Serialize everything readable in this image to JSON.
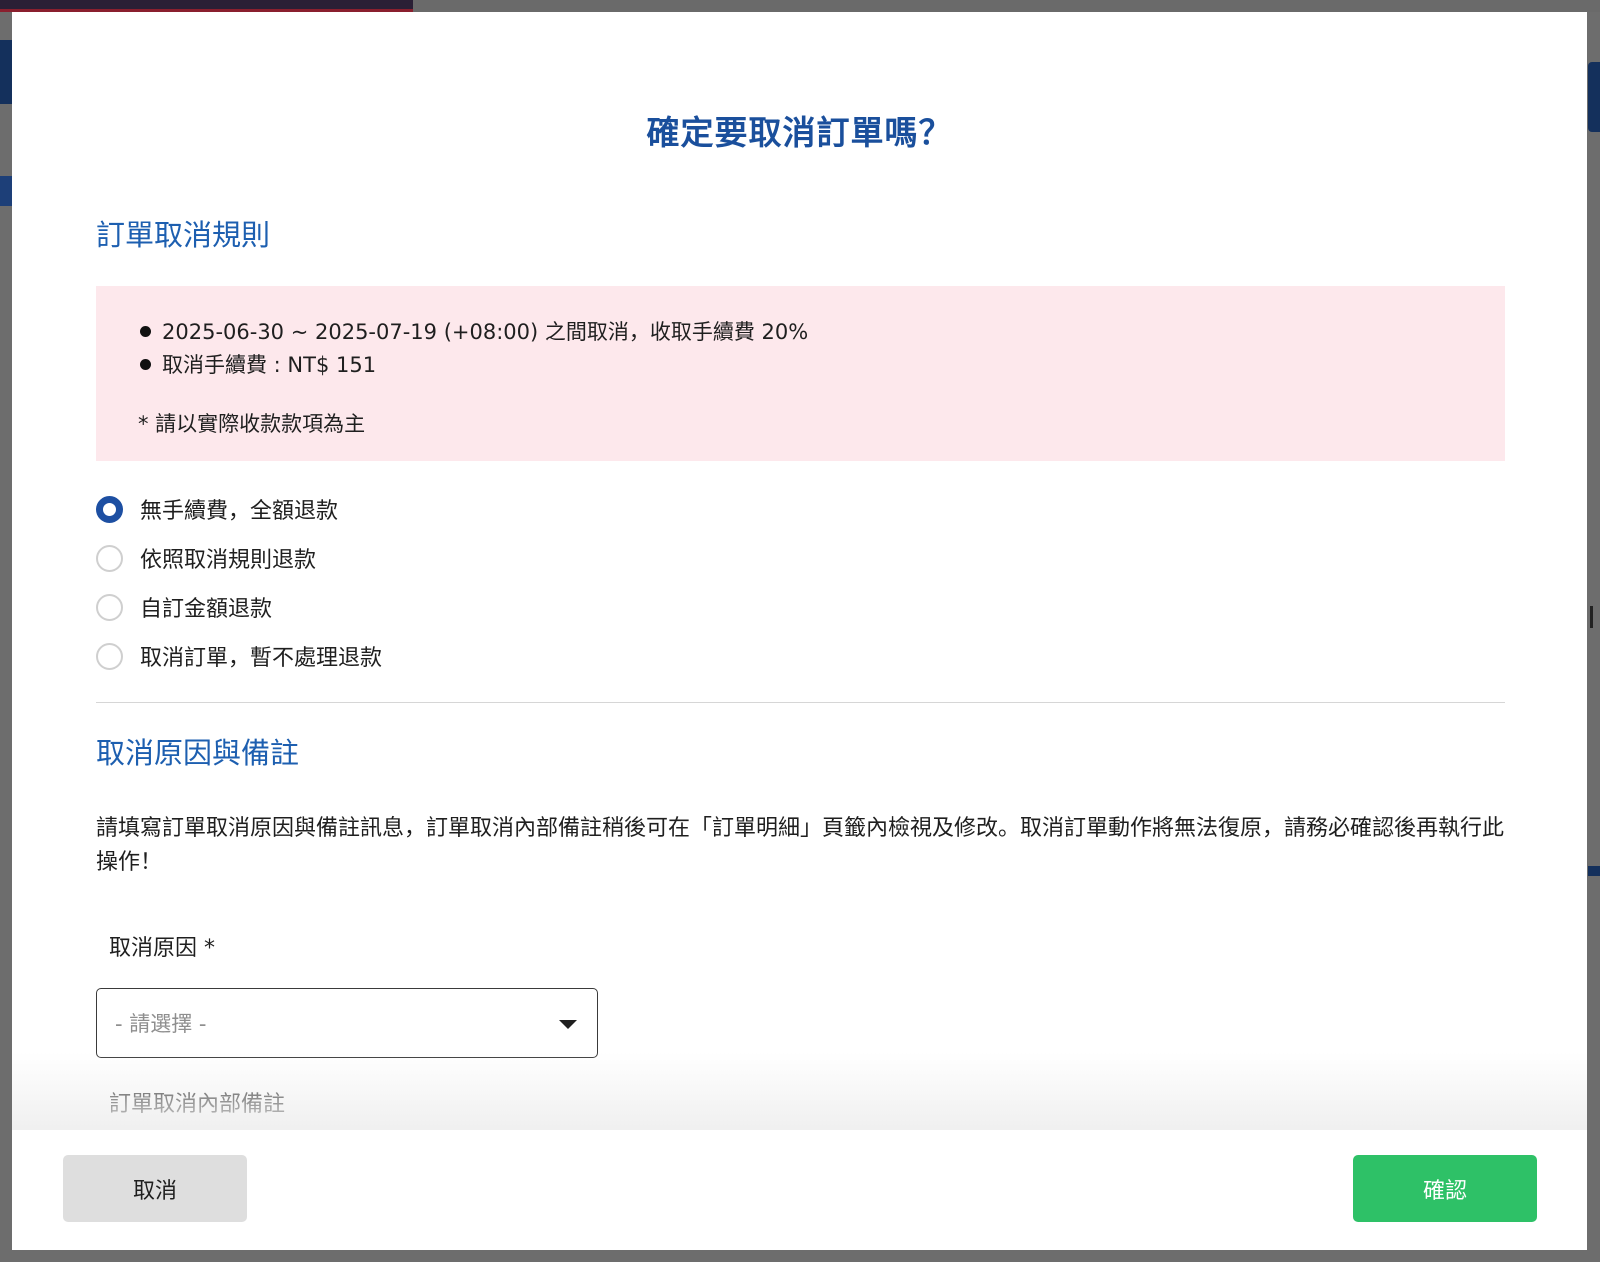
{
  "modal": {
    "title": "確定要取消訂單嗎？"
  },
  "rules_section": {
    "title": "訂單取消規則",
    "rules": [
      "2025-06-30 ~ 2025-07-19 (+08:00) 之間取消，收取手續費 20%",
      "取消手續費 : NT$ 151"
    ],
    "note": "* 請以實際收款款項為主"
  },
  "refund_options": [
    {
      "label": "無手續費，全額退款",
      "checked": true
    },
    {
      "label": "依照取消規則退款",
      "checked": false
    },
    {
      "label": "自訂金額退款",
      "checked": false
    },
    {
      "label": "取消訂單，暫不處理退款",
      "checked": false
    }
  ],
  "reason_section": {
    "title": "取消原因與備註",
    "description": "請填寫訂單取消原因與備註訊息，訂單取消內部備註稍後可在「訂單明細」頁籤內檢視及修改。取消訂單動作將無法復原，請務必確認後再執行此操作！",
    "reason_label": "取消原因 *",
    "reason_placeholder": "- 請選擇 -",
    "note_label": "訂單取消內部備註"
  },
  "footer": {
    "cancel_label": "取消",
    "confirm_label": "確認"
  },
  "colors": {
    "title": "#1a4f9c",
    "section_title": "#1d5fb0",
    "rules_bg": "#fde8ec",
    "radio_checked": "#1d4fa2",
    "confirm_bg": "#2ec167",
    "cancel_bg": "#dedede",
    "overlay": "#6d6d6d"
  }
}
